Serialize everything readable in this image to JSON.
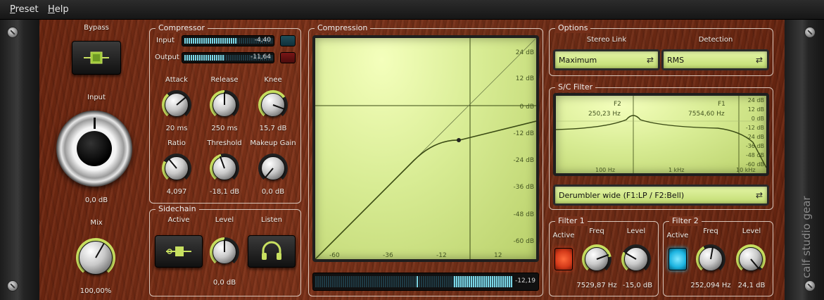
{
  "menu": {
    "preset": "Preset",
    "help": "Help"
  },
  "brand": "calf studio gear",
  "colors": {
    "accent": "#c8e060",
    "display": "#d8ec94",
    "meter": "#7bd6e6",
    "led_red": "#d43a1a",
    "led_blue": "#1bb3e0"
  },
  "bypass": {
    "label": "Bypass"
  },
  "input": {
    "label": "Input",
    "value": "0,0 dB"
  },
  "mix": {
    "label": "Mix",
    "value": "100,00%",
    "level": 1.0
  },
  "compressor": {
    "title": "Compressor",
    "input_meter": {
      "label": "Input",
      "value": "-4,40",
      "level": 0.78
    },
    "output_meter": {
      "label": "Output",
      "value": "-11,64",
      "level": 0.55
    },
    "attack": {
      "label": "Attack",
      "value": "20 ms",
      "level": 0.35
    },
    "release": {
      "label": "Release",
      "value": "250 ms",
      "level": 0.5
    },
    "knee": {
      "label": "Knee",
      "value": "15,7 dB",
      "level": 0.7
    },
    "ratio": {
      "label": "Ratio",
      "value": "4,097",
      "level": 0.3
    },
    "threshold": {
      "label": "Threshold",
      "value": "-18,1 dB",
      "level": 0.45
    },
    "makeup": {
      "label": "Makeup Gain",
      "value": "0,0 dB",
      "level": 0.0
    }
  },
  "sidechain": {
    "title": "Sidechain",
    "active": {
      "label": "Active"
    },
    "level": {
      "label": "Level",
      "value": "0,0 dB",
      "level": 0.5
    },
    "listen": {
      "label": "Listen"
    }
  },
  "compression": {
    "title": "Compression",
    "y_ticks": [
      "24 dB",
      "12 dB",
      "0 dB",
      "-12 dB",
      "-24 dB",
      "-36 dB",
      "-48 dB",
      "-60 dB"
    ],
    "x_ticks": [
      "-60",
      "-36",
      "-12",
      "12"
    ],
    "gr_meter_value": "-12,19",
    "gr_level": 0.45
  },
  "options": {
    "title": "Options",
    "stereo_link": {
      "label": "Stereo Link",
      "value": "Maximum"
    },
    "detection": {
      "label": "Detection",
      "value": "RMS"
    }
  },
  "sc_filter": {
    "title": "S/C Filter",
    "f2": {
      "label": "F2",
      "value": "250,23 Hz"
    },
    "f1": {
      "label": "F1",
      "value": "7554,60 Hz"
    },
    "y_ticks": [
      "24 dB",
      "12 dB",
      "0 dB",
      "-12 dB",
      "-24 dB",
      "-36 dB",
      "-48 dB",
      "-60 dB"
    ],
    "x_ticks": [
      "100 Hz",
      "1 kHz",
      "10 kHz"
    ],
    "mode": "Derumbler wide (F1:LP / F2:Bell)"
  },
  "filter1": {
    "title": "Filter 1",
    "active_label": "Active",
    "freq": {
      "label": "Freq",
      "value": "7529,87 Hz",
      "level": 0.78
    },
    "level": {
      "label": "Level",
      "value": "-15,0 dB",
      "level": 0.3
    }
  },
  "filter2": {
    "title": "Filter 2",
    "active_label": "Active",
    "freq": {
      "label": "Freq",
      "value": "252,094 Hz",
      "level": 0.4
    },
    "level": {
      "label": "Level",
      "value": "24,1 dB",
      "level": 0.95
    }
  }
}
